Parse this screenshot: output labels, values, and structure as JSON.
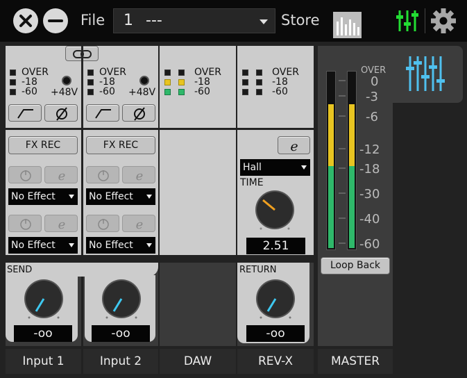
{
  "topbar": {
    "file_label": "File",
    "file_number": "1",
    "file_name": "---",
    "store_label": "Store"
  },
  "meter": {
    "over": "OVER",
    "m18": "-18",
    "m60": "-60",
    "phantom": "+48V"
  },
  "fx": {
    "fx_rec_label": "FX REC",
    "no_effect": "No Effect"
  },
  "rev": {
    "type": "Hall",
    "time_label": "TIME",
    "time_value": "2.51"
  },
  "send": {
    "label": "SEND",
    "value": "-oo"
  },
  "return": {
    "label": "RETURN",
    "value": "-oo"
  },
  "master": {
    "scale": [
      "OVER",
      "0",
      "-3",
      "-6",
      "-12",
      "-18",
      "-30",
      "-40",
      "-60"
    ],
    "level_left": 0.82,
    "level_right": 0.82,
    "loopback_label": "Loop Back"
  },
  "channels": [
    "Input 1",
    "Input 2",
    "DAW",
    "REV-X",
    "MASTER"
  ]
}
